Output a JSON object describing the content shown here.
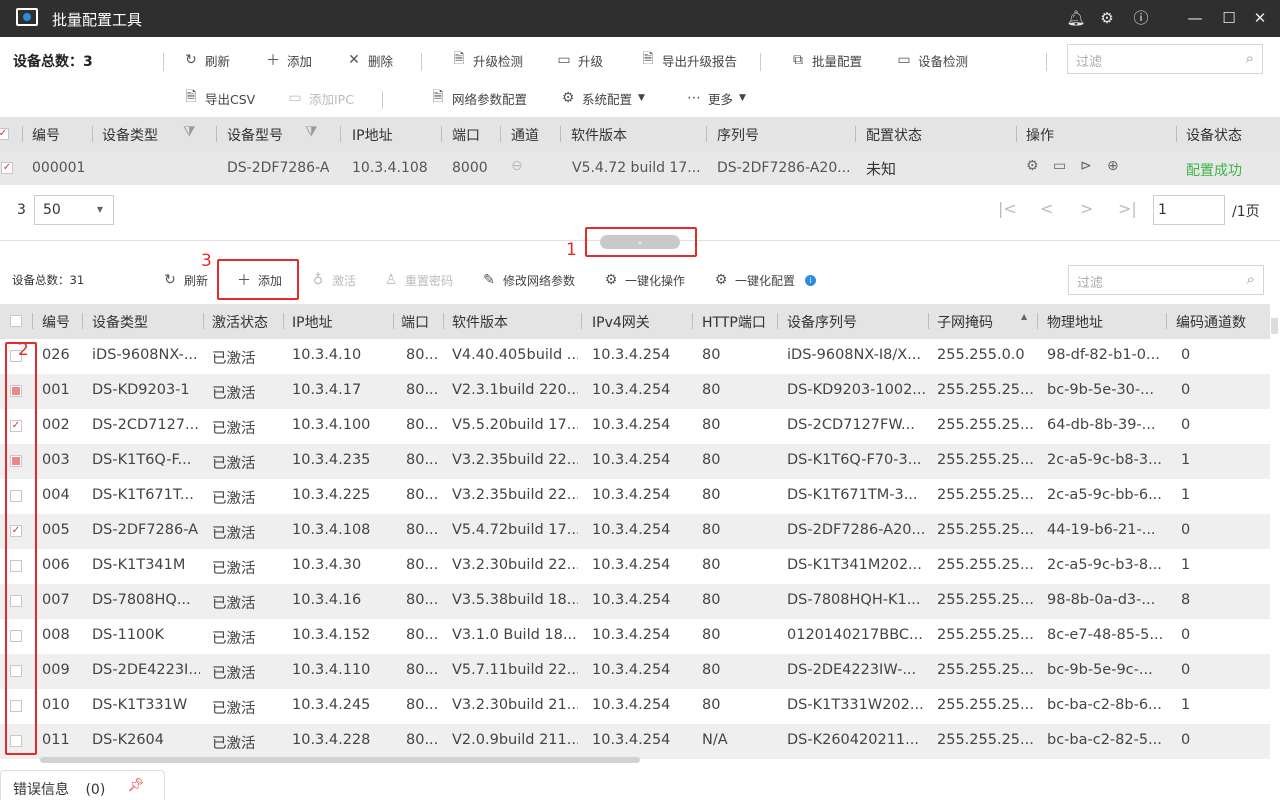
{
  "window": {
    "title": "批量配置工具"
  },
  "toolbar1": {
    "total_label": "设备总数：3",
    "refresh": "刷新",
    "add": "添加",
    "delete": "删除",
    "upgrade_check": "升级检测",
    "upgrade": "升级",
    "export_report": "导出升级报告",
    "batch_config": "批量配置",
    "device_check": "设备检测",
    "export_csv": "导出CSV",
    "add_ipc": "添加IPC",
    "network_config": "网络参数配置",
    "system_config": "系统配置",
    "more": "更多",
    "filter_placeholder": "过滤"
  },
  "top_table": {
    "headers": [
      "编号",
      "设备类型",
      "设备型号",
      "IP地址",
      "端口",
      "通道",
      "软件版本",
      "序列号",
      "配置状态",
      "操作",
      "设备状态"
    ],
    "row": {
      "id": "000001",
      "type": "",
      "model": "DS-2DF7286-A",
      "ip": "10.3.4.108",
      "port": "8000",
      "channel": "",
      "version": "V5.4.72 build 17...",
      "serial": "DS-2DF7286-A20...",
      "config_state": "未知",
      "device_state": "配置成功"
    }
  },
  "pager": {
    "count": "3",
    "page_size": "50",
    "page": "1",
    "total_pages": "/1页"
  },
  "annotations": {
    "one": "1",
    "two": "2",
    "three": "3"
  },
  "toolbar2": {
    "total_label": "设备总数：31",
    "refresh": "刷新",
    "add": "添加",
    "activate": "激活",
    "reset_password": "重置密码",
    "modify_network": "修改网络参数",
    "one_key_op": "一键化操作",
    "one_key_config": "一键化配置",
    "filter_placeholder": "过滤"
  },
  "bottom_table": {
    "headers": [
      "编号",
      "设备类型",
      "激活状态",
      "IP地址",
      "端口",
      "软件版本",
      "IPv4网关",
      "HTTP端口",
      "设备序列号",
      "子网掩码",
      "物理地址",
      "编码通道数"
    ],
    "rows": [
      {
        "id": "026",
        "type": "iDS-9608NX-...",
        "status": "已激活",
        "ip": "10.3.4.10",
        "port": "80...",
        "version": "V4.40.405build ...",
        "gateway": "10.3.4.254",
        "http": "80",
        "serial": "iDS-9608NX-I8/X...",
        "mask": "255.255.0.0",
        "mac": "98-df-82-b1-0...",
        "channels": "0"
      },
      {
        "id": "001",
        "type": "DS-KD9203-1",
        "status": "已激活",
        "ip": "10.3.4.17",
        "port": "80...",
        "version": "V2.3.1build 220...",
        "gateway": "10.3.4.254",
        "http": "80",
        "serial": "DS-KD9203-1002...",
        "mask": "255.255.25...",
        "mac": "bc-9b-5e-30-...",
        "channels": "0"
      },
      {
        "id": "002",
        "type": "DS-2CD7127...",
        "status": "已激活",
        "ip": "10.3.4.100",
        "port": "80...",
        "version": "V5.5.20build 17...",
        "gateway": "10.3.4.254",
        "http": "80",
        "serial": "DS-2CD7127FW...",
        "mask": "255.255.25...",
        "mac": "64-db-8b-39-...",
        "channels": "0"
      },
      {
        "id": "003",
        "type": "DS-K1T6Q-F...",
        "status": "已激活",
        "ip": "10.3.4.235",
        "port": "80...",
        "version": "V3.2.35build 22...",
        "gateway": "10.3.4.254",
        "http": "80",
        "serial": "DS-K1T6Q-F70-3...",
        "mask": "255.255.25...",
        "mac": "2c-a5-9c-b8-3...",
        "channels": "1"
      },
      {
        "id": "004",
        "type": "DS-K1T671T...",
        "status": "已激活",
        "ip": "10.3.4.225",
        "port": "80...",
        "version": "V3.2.35build 22...",
        "gateway": "10.3.4.254",
        "http": "80",
        "serial": "DS-K1T671TM-3...",
        "mask": "255.255.25...",
        "mac": "2c-a5-9c-bb-6...",
        "channels": "1"
      },
      {
        "id": "005",
        "type": "DS-2DF7286-A",
        "status": "已激活",
        "ip": "10.3.4.108",
        "port": "80...",
        "version": "V5.4.72build 17...",
        "gateway": "10.3.4.254",
        "http": "80",
        "serial": "DS-2DF7286-A20...",
        "mask": "255.255.25...",
        "mac": "44-19-b6-21-...",
        "channels": "0"
      },
      {
        "id": "006",
        "type": "DS-K1T341M",
        "status": "已激活",
        "ip": "10.3.4.30",
        "port": "80...",
        "version": "V3.2.30build 22...",
        "gateway": "10.3.4.254",
        "http": "80",
        "serial": "DS-K1T341M202...",
        "mask": "255.255.25...",
        "mac": "2c-a5-9c-b3-8...",
        "channels": "1"
      },
      {
        "id": "007",
        "type": "DS-7808HQ...",
        "status": "已激活",
        "ip": "10.3.4.16",
        "port": "80...",
        "version": "V3.5.38build 18...",
        "gateway": "10.3.4.254",
        "http": "80",
        "serial": "DS-7808HQH-K1...",
        "mask": "255.255.25...",
        "mac": "98-8b-0a-d3-...",
        "channels": "8"
      },
      {
        "id": "008",
        "type": "DS-1100K",
        "status": "已激活",
        "ip": "10.3.4.152",
        "port": "80...",
        "version": "V3.1.0 Build 18...",
        "gateway": "10.3.4.254",
        "http": "80",
        "serial": "0120140217BBC...",
        "mask": "255.255.25...",
        "mac": "8c-e7-48-85-5...",
        "channels": "0"
      },
      {
        "id": "009",
        "type": "DS-2DE4223I...",
        "status": "已激活",
        "ip": "10.3.4.110",
        "port": "80...",
        "version": "V5.7.11build 22...",
        "gateway": "10.3.4.254",
        "http": "80",
        "serial": "DS-2DE4223IW-...",
        "mask": "255.255.25...",
        "mac": "bc-9b-5e-9c-...",
        "channels": "0"
      },
      {
        "id": "010",
        "type": "DS-K1T331W",
        "status": "已激活",
        "ip": "10.3.4.245",
        "port": "80...",
        "version": "V3.2.30build 21...",
        "gateway": "10.3.4.254",
        "http": "80",
        "serial": "DS-K1T331W202...",
        "mask": "255.255.25...",
        "mac": "bc-ba-c2-8b-6...",
        "channels": "1"
      },
      {
        "id": "011",
        "type": "DS-K2604",
        "status": "已激活",
        "ip": "10.3.4.228",
        "port": "80...",
        "version": "V2.0.9build 211...",
        "gateway": "10.3.4.254",
        "http": "N/A",
        "serial": "DS-K260420211...",
        "mask": "255.255.25...",
        "mac": "bc-ba-c2-82-5...",
        "channels": "0"
      }
    ],
    "checkbox_states": [
      "none",
      "partial",
      "checked",
      "partial",
      "none",
      "checked",
      "none",
      "none",
      "none",
      "none",
      "none",
      "none"
    ]
  },
  "statusbar": {
    "label": "错误信息",
    "count": "(0)"
  },
  "colors": {
    "accent": "#2a8de0",
    "annotation": "#e52a2a",
    "success": "#3cb44b"
  }
}
